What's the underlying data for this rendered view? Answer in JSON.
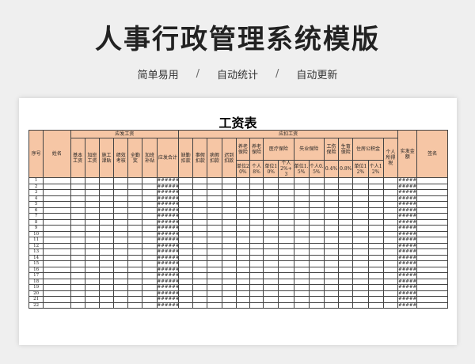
{
  "page": {
    "title": "人事行政管理系统模版",
    "subtitle_items": [
      "简单易用",
      "自动统计",
      "自动更新"
    ],
    "separator": "/"
  },
  "sheet": {
    "title": "工资表",
    "headers": {
      "seq": "序号",
      "name": "姓名",
      "payable_group": "应发工资",
      "payable_cols": [
        "基本工资",
        "加班工资",
        "施工津贴",
        "绩效考核",
        "全勤奖",
        "加班补贴",
        "应发合计"
      ],
      "deduct_group": "应扣工资",
      "deduct_simple": [
        "缺勤扣款",
        "事假扣款",
        "病假扣款",
        "迟到扣款"
      ],
      "pension": "养老保险",
      "pension_sub": [
        "单位20%",
        "个人8%"
      ],
      "medical": "医疗保险",
      "medical_sub": [
        "单位10%",
        "个人2%+3"
      ],
      "unemployment": "失业保险",
      "unemployment_sub": [
        "单位1.5%",
        "个人0.5%"
      ],
      "injury": "工伤保险",
      "injury_sub": "0.4%",
      "maternity": "生育保险",
      "maternity_sub": "0.8%",
      "housing": "住房公积金",
      "housing_sub": [
        "单位12%",
        "个人12%"
      ],
      "income_tax": "个人所得税",
      "net_pay": "实发金额",
      "signature": "签名"
    },
    "row_count": 22,
    "formula_placeholder": "######"
  }
}
